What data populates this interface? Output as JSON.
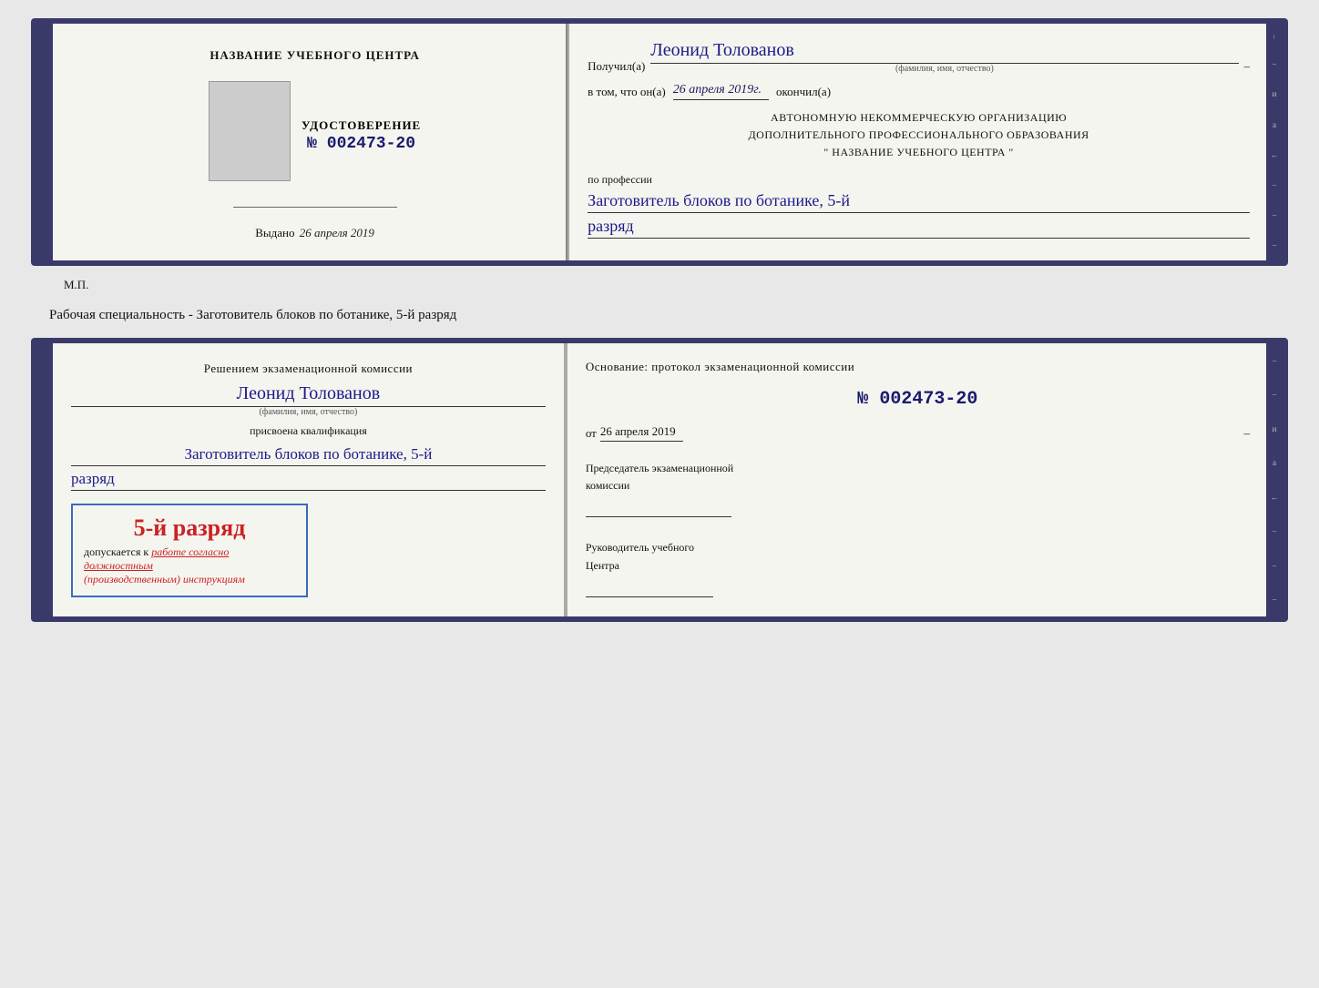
{
  "page": {
    "background": "#e8e8e8"
  },
  "top_doc": {
    "left": {
      "section_title": "НАЗВАНИЕ УЧЕБНОГО ЦЕНТРА",
      "udost_label": "УДОСТОВЕРЕНИЕ",
      "udost_number": "№ 002473-20",
      "vydano_label": "Выдано",
      "vydano_date": "26 апреля 2019",
      "mp_label": "М.П."
    },
    "right": {
      "poluchil_prefix": "Получил(а)",
      "poluchil_name": "Леонид Толованов",
      "dash": "–",
      "fio_label": "(фамилия, имя, отчество)",
      "vtom_prefix": "в том, что он(а)",
      "vtom_date": "26 апреля 2019г.",
      "okончил": "окончил(а)",
      "org_line1": "АВТОНОМНУЮ НЕКОММЕРЧЕСКУЮ ОРГАНИЗАЦИЮ",
      "org_line2": "ДОПОЛНИТЕЛЬНОГО ПРОФЕССИОНАЛЬНОГО ОБРАЗОВАНИЯ",
      "org_line3": "\"   НАЗВАНИЕ УЧЕБНОГО ЦЕНТРА   \"",
      "po_professii": "по профессии",
      "professiya": "Заготовитель блоков по ботанике, 5-й",
      "razryad": "разряд"
    }
  },
  "separator": {
    "text": "Рабочая специальность - Заготовитель блоков по ботанике, 5-й разряд"
  },
  "bottom_doc": {
    "left": {
      "resheniem_label": "Решением экзаменационной комиссии",
      "person_name": "Леонид Толованов",
      "fio_label": "(фамилия, имя, отчество)",
      "prisvoena_label": "присвоена квалификация",
      "qualification": "Заготовитель блоков по ботанике, 5-й",
      "razryad": "разряд",
      "stamp_razryad": "5-й разряд",
      "dopuskaetsya_prefix": "допускается к",
      "dopuskaetsya_text": "работе согласно должностным",
      "dopuskaetsya_text2": "(производственным) инструкциям"
    },
    "right": {
      "osnovaniye_label": "Основание: протокол экзаменационной комиссии",
      "protocol_number": "№  002473-20",
      "ot_prefix": "от",
      "ot_date": "26 апреля 2019",
      "predsedatel_line1": "Председатель экзаменационной",
      "predsedatel_line2": "комиссии",
      "rukovoditel_line1": "Руководитель учебного",
      "rukovoditel_line2": "Центра"
    }
  }
}
